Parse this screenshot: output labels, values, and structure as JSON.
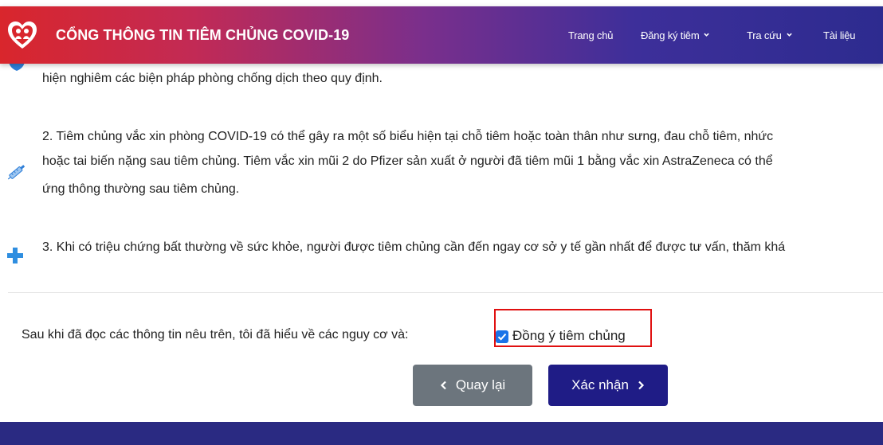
{
  "header": {
    "title": "CỔNG THÔNG TIN TIÊM CHỦNG COVID-19",
    "logo_icon": "heart-family-logo-icon",
    "nav": [
      {
        "label": "Trang chủ",
        "has_dropdown": false
      },
      {
        "label": "Đăng ký tiêm",
        "has_dropdown": true
      },
      {
        "label": "Tra cứu",
        "has_dropdown": true
      },
      {
        "label": "Tài liệu",
        "has_dropdown": false
      }
    ]
  },
  "content": {
    "para1_line": "hiện nghiêm các biện pháp phòng chống dịch theo quy định.",
    "para2_lines": [
      "2. Tiêm chủng vắc xin phòng COVID-19 có thể gây ra một số biểu hiện tại chỗ tiêm hoặc toàn thân như sưng, đau chỗ tiêm, nhức",
      "hoặc tai biến nặng sau tiêm chủng. Tiêm vắc xin mũi 2 do Pfizer sản xuất ở người đã tiêm mũi 1 bằng vắc xin AstraZeneca có thể",
      "ứng thông thường sau tiêm chủng."
    ],
    "para3_line": "3. Khi có triệu chứng bất thường về sức khỏe, người được tiêm chủng cần đến ngay cơ sở y tế gần nhất để được tư vấn, thăm khá",
    "icons": [
      "shield-icon",
      "syringe-icon",
      "medical-cross-icon"
    ]
  },
  "consent": {
    "statement": "Sau khi đã đọc các thông tin nêu trên, tôi đã hiểu về các nguy cơ và:",
    "checkbox_label": "Đồng ý tiêm chủng",
    "checked": true
  },
  "actions": {
    "back_label": "Quay lại",
    "confirm_label": "Xác nhận"
  },
  "colors": {
    "header_start": "#d9262c",
    "header_end": "#2d2b8f",
    "back_button": "#6c757d",
    "confirm_button": "#1f1c86",
    "footer": "#2a2a82",
    "highlight": "#e01010",
    "checkbox": "#1a73e8"
  }
}
